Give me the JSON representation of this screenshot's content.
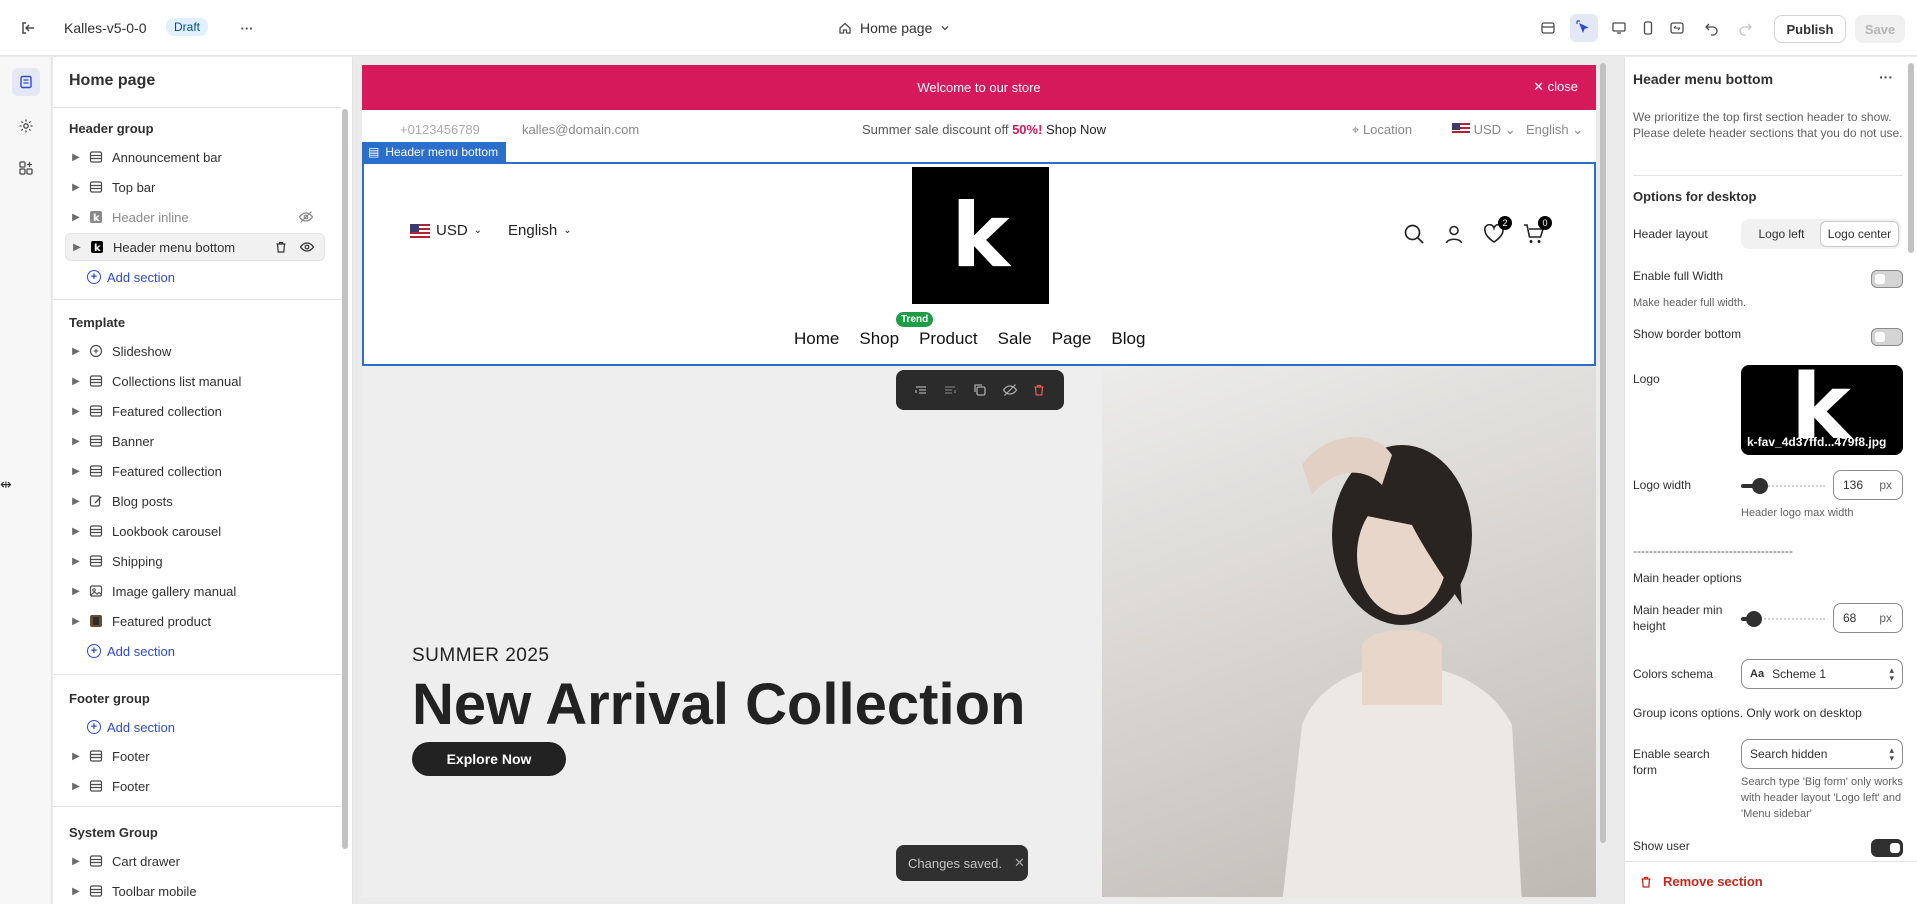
{
  "topbar": {
    "theme_name": "Kalles-v5-0-0",
    "status_badge": "Draft",
    "page_selector": "Home page",
    "publish_label": "Publish",
    "save_label": "Save"
  },
  "left_panel": {
    "title": "Home page",
    "header_group": {
      "title": "Header group",
      "items": [
        {
          "label": "Announcement bar"
        },
        {
          "label": "Top bar"
        },
        {
          "label": "Header inline"
        },
        {
          "label": "Header menu bottom"
        }
      ],
      "add_section": "Add section"
    },
    "template": {
      "title": "Template",
      "items": [
        {
          "label": "Slideshow"
        },
        {
          "label": "Collections list manual"
        },
        {
          "label": "Featured collection"
        },
        {
          "label": "Banner"
        },
        {
          "label": "Featured collection"
        },
        {
          "label": "Blog posts"
        },
        {
          "label": "Lookbook carousel"
        },
        {
          "label": "Shipping"
        },
        {
          "label": "Image gallery manual"
        },
        {
          "label": "Featured product"
        }
      ],
      "add_section": "Add section"
    },
    "footer_group": {
      "title": "Footer group",
      "add_section": "Add section",
      "items": [
        {
          "label": "Footer"
        },
        {
          "label": "Footer"
        }
      ]
    },
    "system_group": {
      "title": "System Group",
      "items": [
        {
          "label": "Cart drawer"
        },
        {
          "label": "Toolbar mobile"
        }
      ]
    }
  },
  "preview": {
    "announcement": "Welcome to our store",
    "announcement_close": "close",
    "topline": {
      "phone": "+0123456789",
      "email": "kalles@domain.com",
      "promo_prefix": "Summer sale discount off ",
      "promo_percent": "50%!",
      "promo_link": "Shop Now",
      "location": "Location",
      "currency": "USD",
      "language": "English"
    },
    "selected_section_tag": "Header menu bottom",
    "header": {
      "currency": "USD",
      "language": "English",
      "logo_letter": "k",
      "trend_badge": "Trend",
      "nav": [
        "Home",
        "Shop",
        "Product",
        "Sale",
        "Page",
        "Blog"
      ],
      "wishlist_count": "2",
      "cart_count": "0"
    },
    "hero": {
      "subtitle": "SUMMER 2025",
      "title": "New Arrival Collection",
      "button": "Explore Now"
    },
    "toast": "Changes saved."
  },
  "right_panel": {
    "title": "Header menu bottom",
    "intro": "We prioritize the top first section header to show. Please delete header sections that you do not use.",
    "options_desktop": "Options for desktop",
    "header_layout_label": "Header layout",
    "header_layout_options": [
      "Logo left",
      "Logo center"
    ],
    "header_layout_selected": "Logo center",
    "enable_full_width": "Enable full Width",
    "full_width_help": "Make header full width.",
    "show_border_bottom": "Show border bottom",
    "logo_label": "Logo",
    "logo_letter": "k",
    "logo_filename": "k-fav_4d37ffd...479f8.jpg",
    "logo_width_label": "Logo width",
    "logo_width_value": "136",
    "logo_width_unit": "px",
    "logo_width_help": "Header logo max width",
    "divider_text": "----------------------------------------",
    "main_header_options": "Main header options",
    "main_header_min_height_label": "Main header min height",
    "main_header_min_height_value": "68",
    "main_header_min_height_unit": "px",
    "colors_schema_label": "Colors schema",
    "colors_schema_value": "Scheme 1",
    "group_icons_text": "Group icons options. Only work on desktop",
    "enable_search_label": "Enable search form",
    "enable_search_value": "Search hidden",
    "search_help": "Search type 'Big form' only works with header layout 'Logo left' and 'Menu sidebar'",
    "show_user_label": "Show user",
    "remove_section": "Remove section",
    "toggles": {
      "full_width": false,
      "border_bottom": false,
      "show_user": true
    },
    "logo_width_fraction": 0.23,
    "min_height_fraction": 0.15
  },
  "colors": {
    "announcement_bg": "#d6195b",
    "accent": "#2c4bd6",
    "selection_outline": "#2c6ecb",
    "remove": "#c7281b",
    "trend_badge": "#1d9e46"
  }
}
